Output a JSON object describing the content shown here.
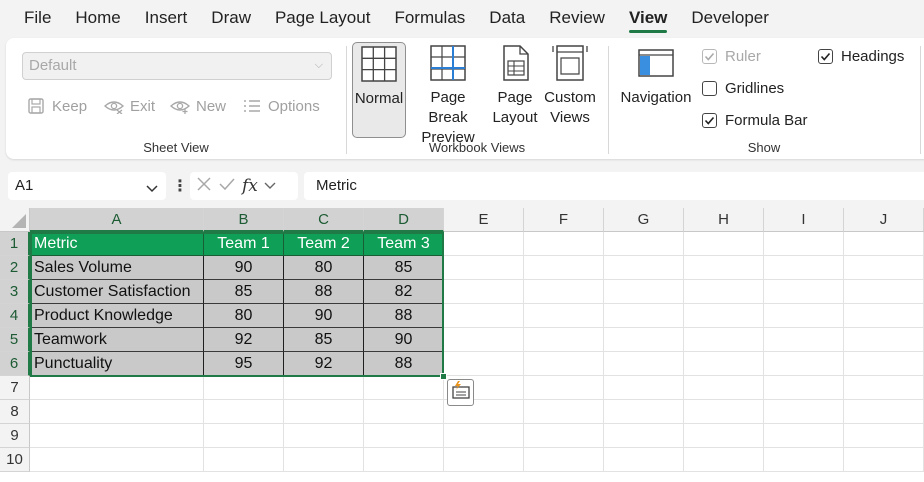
{
  "menu": {
    "items": [
      {
        "label": "File"
      },
      {
        "label": "Home"
      },
      {
        "label": "Insert"
      },
      {
        "label": "Draw"
      },
      {
        "label": "Page Layout"
      },
      {
        "label": "Formulas"
      },
      {
        "label": "Data"
      },
      {
        "label": "Review"
      },
      {
        "label": "View"
      },
      {
        "label": "Developer"
      }
    ],
    "active": "View"
  },
  "ribbon": {
    "sheet_view": {
      "select_value": "Default",
      "keep": "Keep",
      "exit": "Exit",
      "new": "New",
      "options": "Options",
      "group_label": "Sheet View"
    },
    "workbook_views": {
      "normal": "Normal",
      "page_break_1": "Page Break",
      "page_break_2": "Preview",
      "page_layout_1": "Page",
      "page_layout_2": "Layout",
      "custom_1": "Custom",
      "custom_2": "Views",
      "group_label": "Workbook Views"
    },
    "show": {
      "navigation": "Navigation",
      "ruler": "Ruler",
      "gridlines": "Gridlines",
      "formula_bar": "Formula Bar",
      "headings": "Headings",
      "group_label": "Show",
      "ruler_checked": true,
      "gridlines_checked": false,
      "formula_bar_checked": true,
      "headings_checked": true
    }
  },
  "formula_bar": {
    "name_box": "A1",
    "fx": "fx",
    "content": "Metric"
  },
  "grid": {
    "columns": [
      "A",
      "B",
      "C",
      "D",
      "E",
      "F",
      "G",
      "H",
      "I",
      "J"
    ],
    "rows": [
      "1",
      "2",
      "3",
      "4",
      "5",
      "6",
      "7",
      "8",
      "9",
      "10"
    ],
    "header": [
      "Metric",
      "Team 1",
      "Team 2",
      "Team 3"
    ],
    "data": [
      [
        "Sales Volume",
        "90",
        "80",
        "85"
      ],
      [
        "Customer Satisfaction",
        "85",
        "88",
        "82"
      ],
      [
        "Product Knowledge",
        "80",
        "90",
        "88"
      ],
      [
        "Teamwork",
        "92",
        "85",
        "90"
      ],
      [
        "Punctuality",
        "95",
        "92",
        "88"
      ]
    ]
  },
  "colors": {
    "accent": "#1f7a45",
    "header_fill": "#0f9f56",
    "data_fill": "#c9c9c9"
  }
}
